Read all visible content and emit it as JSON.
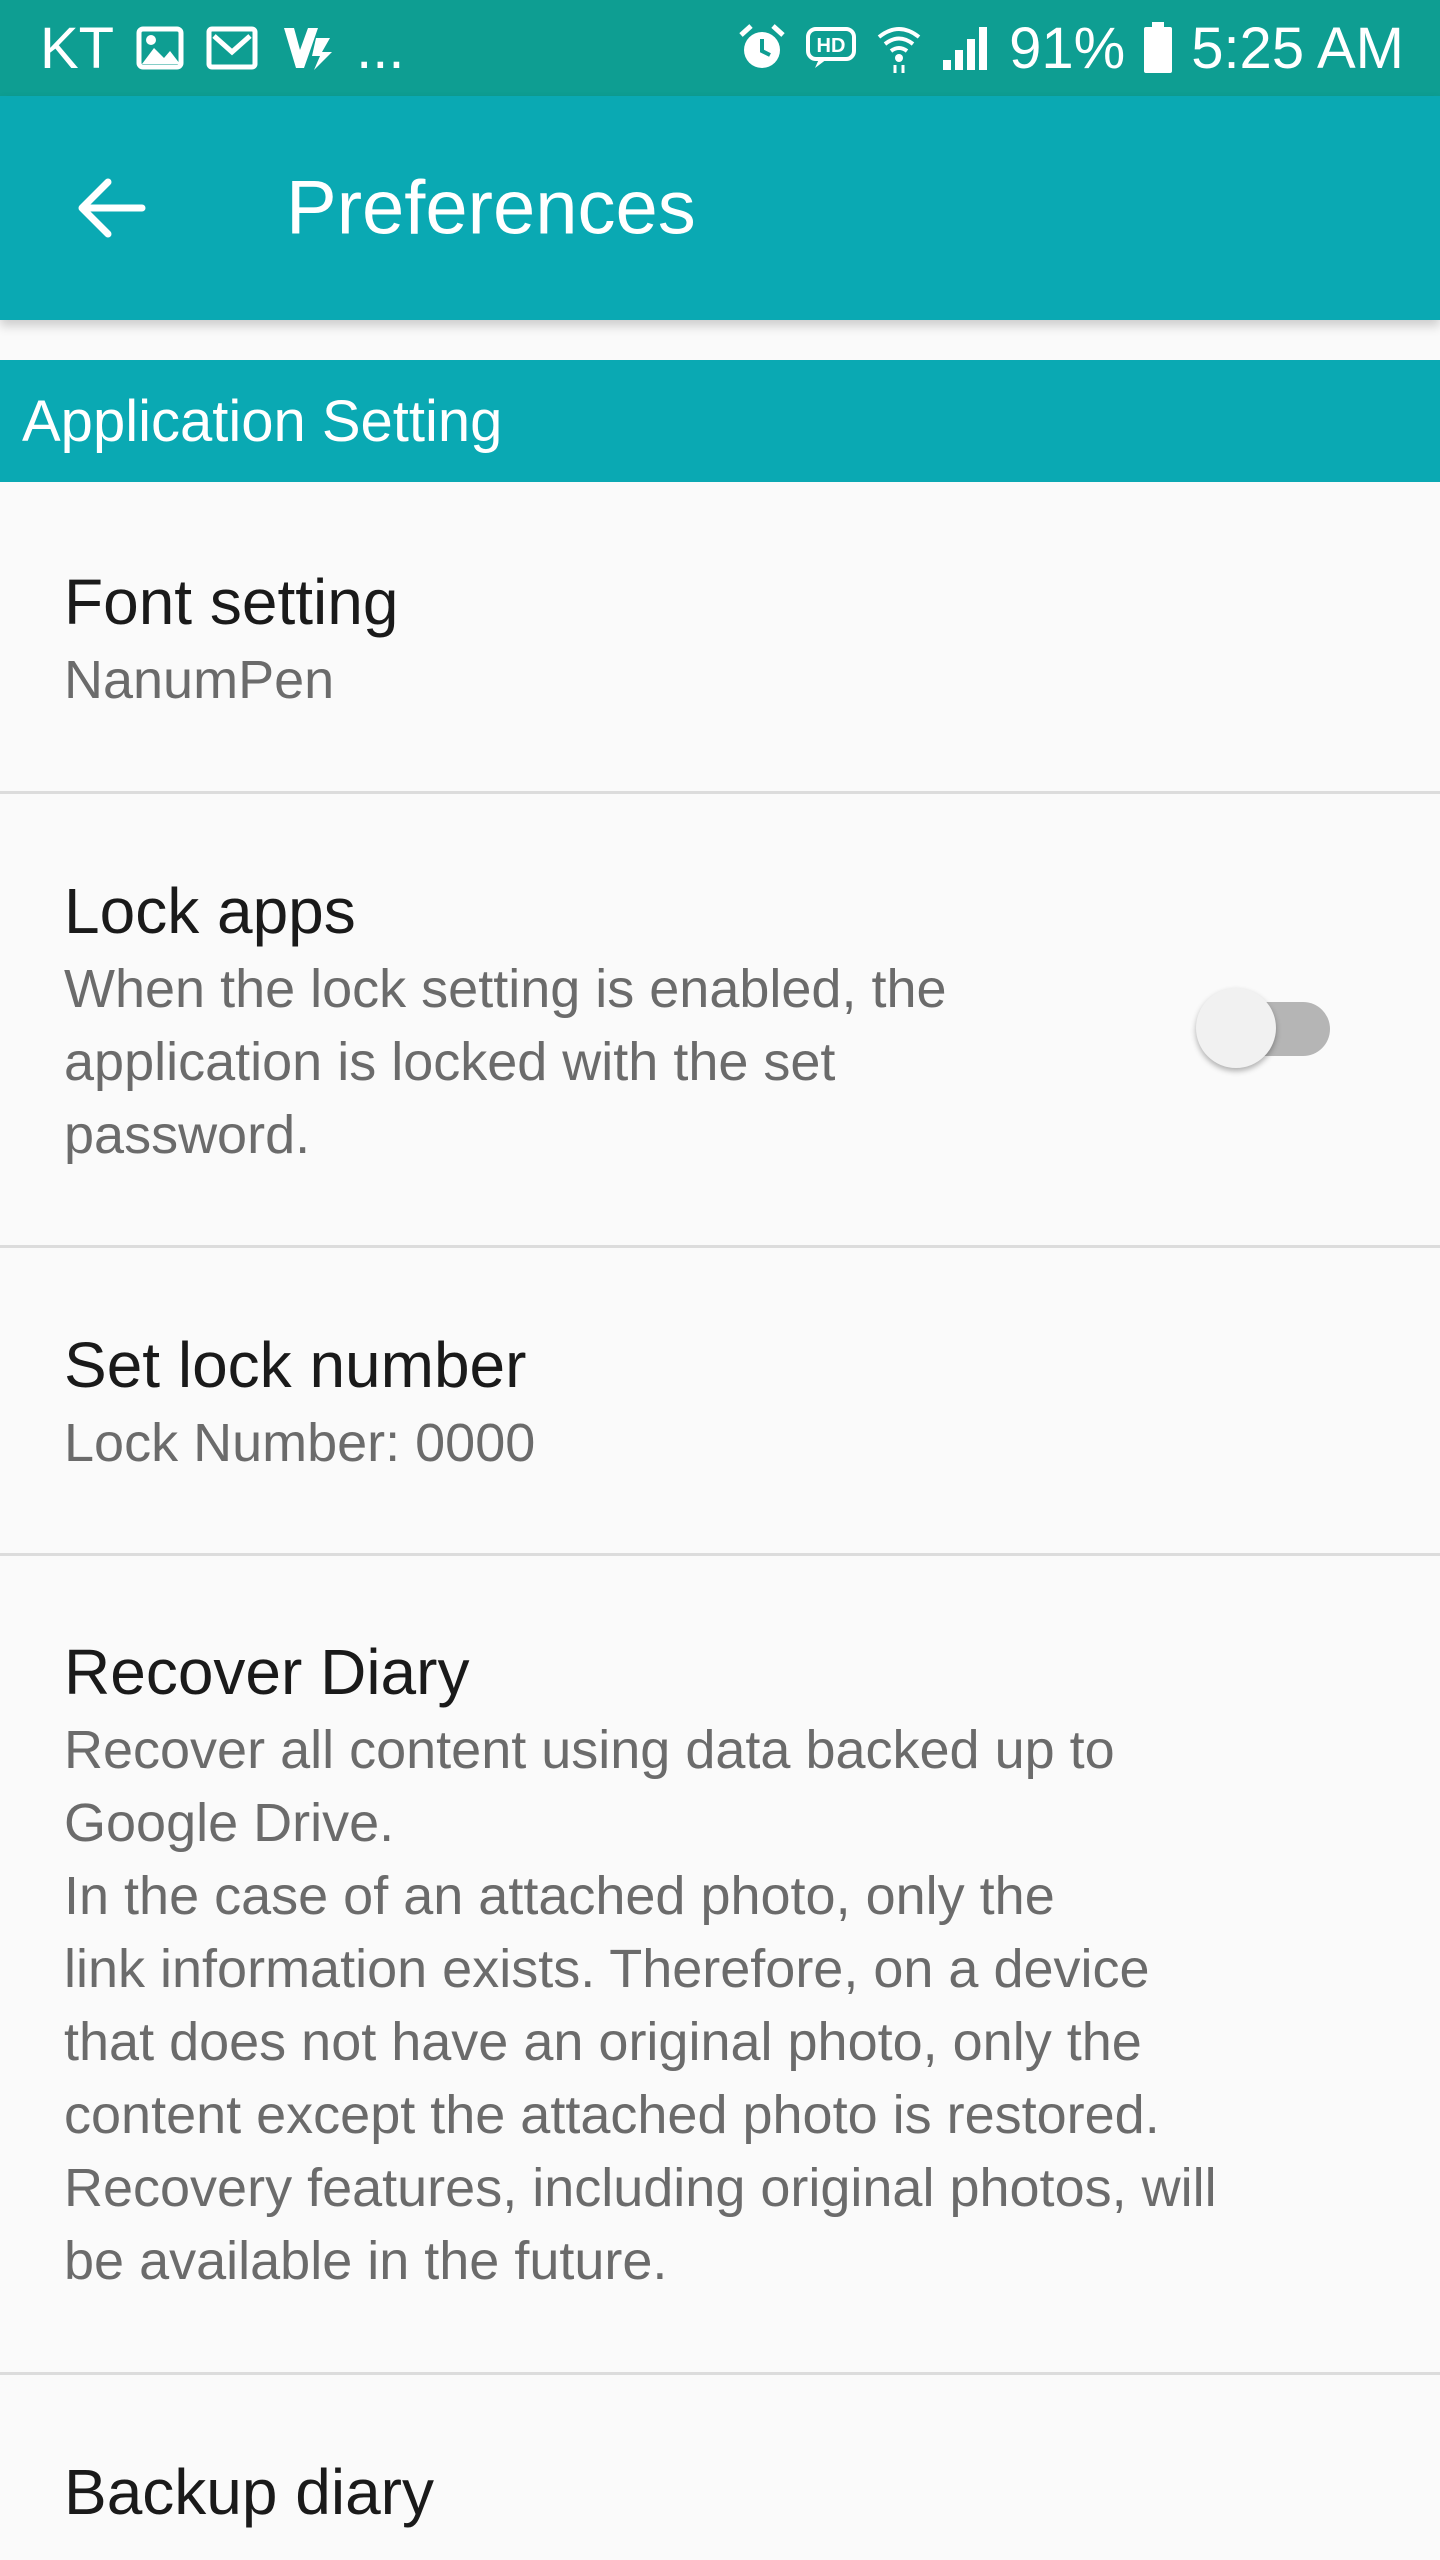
{
  "status_bar": {
    "carrier": "KT",
    "overflow": "...",
    "battery_percent": "91%",
    "time": "5:25 AM",
    "left_icons": [
      "image-icon",
      "mail-icon",
      "app-notification-icon"
    ],
    "right_icons": [
      "alarm-icon",
      "hd-voice-icon",
      "wifi-icon",
      "signal-icon",
      "battery-icon"
    ],
    "color": "#0e9e92"
  },
  "app_bar": {
    "title": "Preferences",
    "back_icon": "arrow-back-icon",
    "color": "#0aa9b3"
  },
  "section": {
    "title": "Application Setting"
  },
  "preferences": [
    {
      "title": "Font setting",
      "summary": "NanumPen"
    },
    {
      "title": "Lock apps",
      "summary": "When the lock setting is enabled, the\napplication is locked with the set\npassword.",
      "toggle_on": false
    },
    {
      "title": "Set lock number",
      "summary": "Lock Number: 0000"
    },
    {
      "title": "Recover Diary",
      "summary": "Recover all content using data backed up to\nGoogle Drive.\nIn the case of an attached photo, only the\nlink information exists. Therefore, on a device\nthat does not have an original photo, only the\ncontent except the attached photo is restored.\nRecovery features, including original photos, will\nbe available in the future."
    },
    {
      "title": "Backup diary"
    }
  ]
}
